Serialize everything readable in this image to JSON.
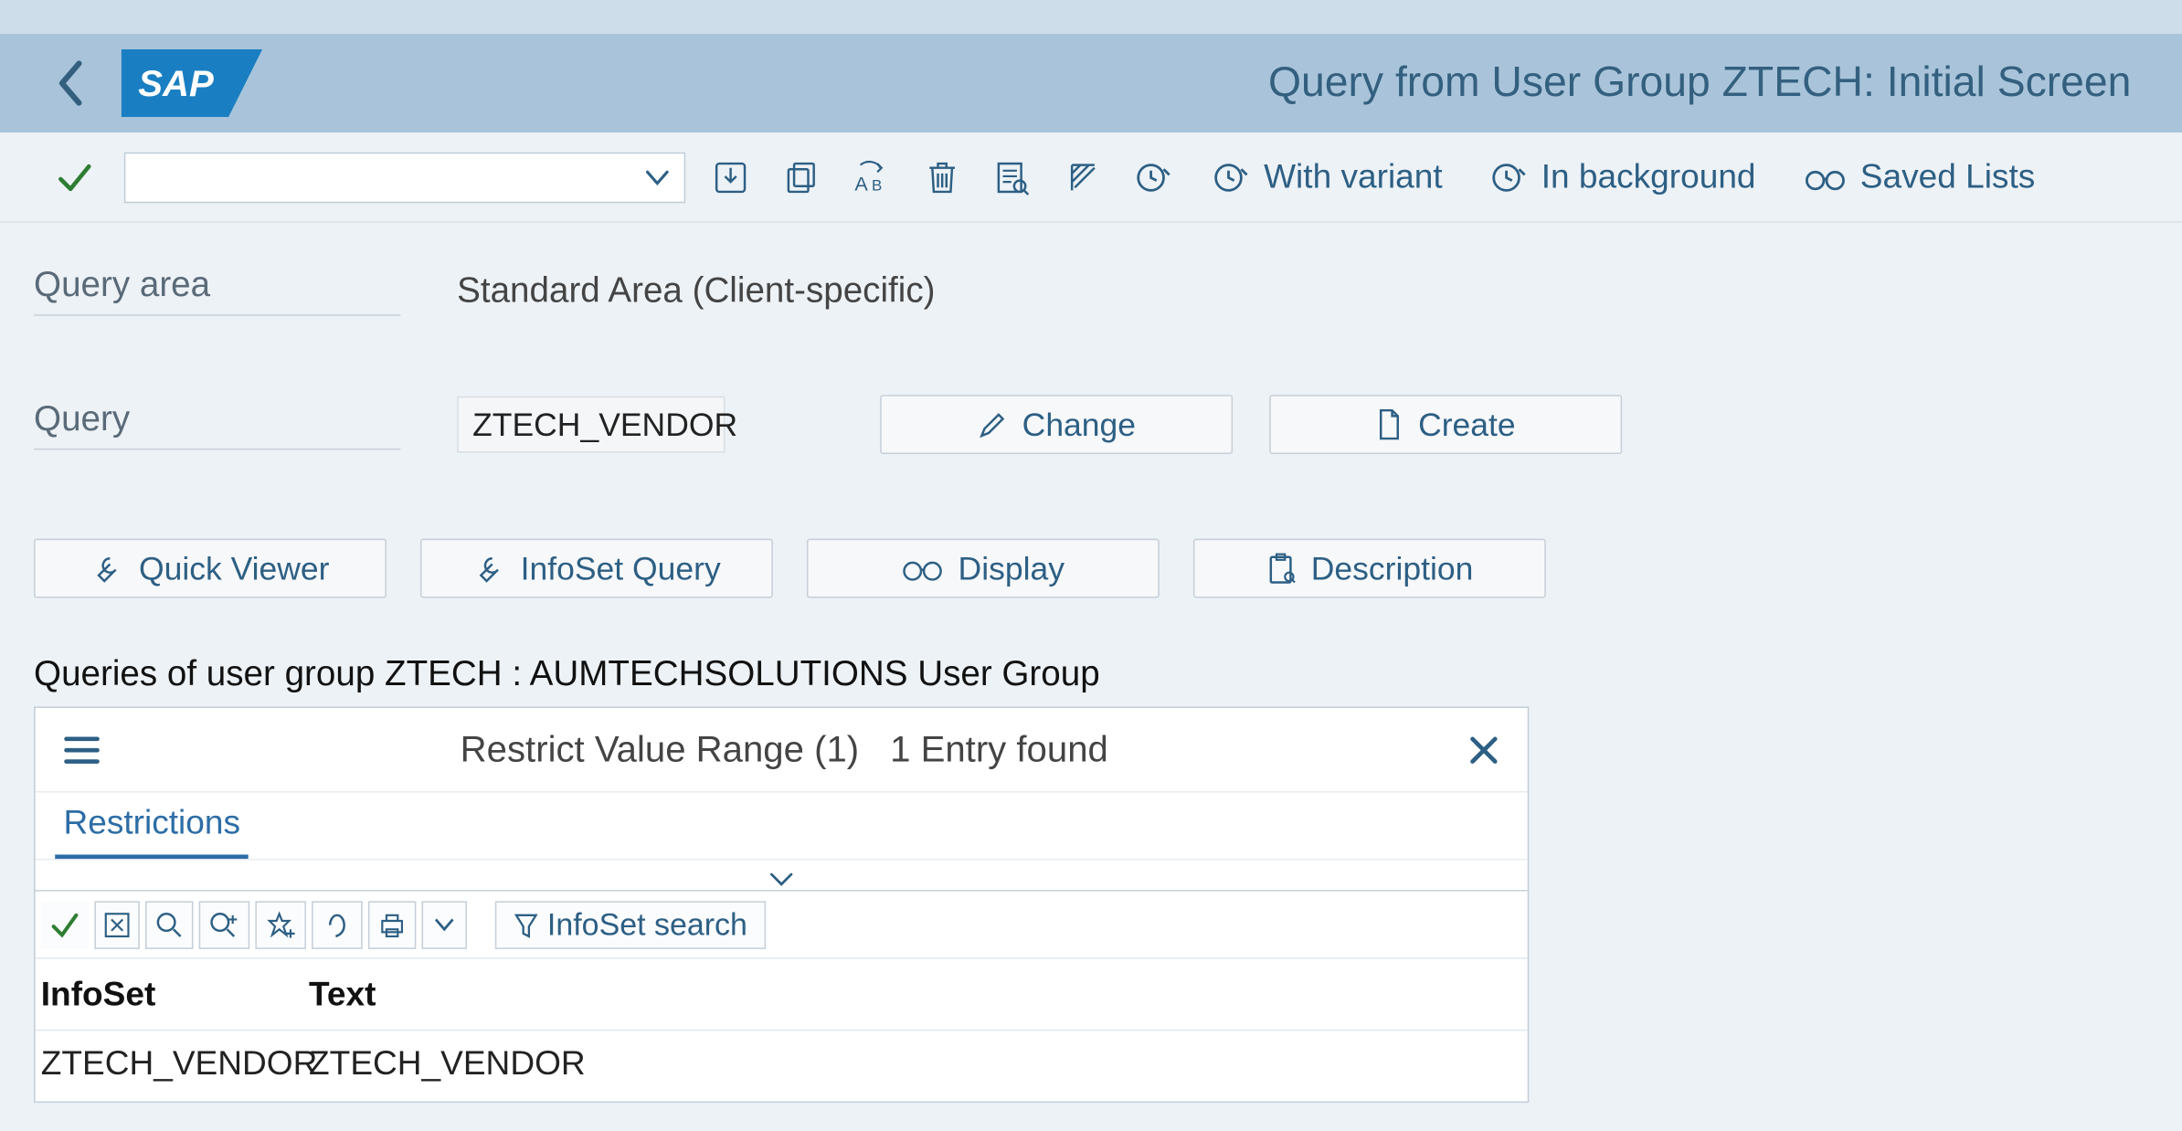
{
  "title": "Query from User Group ZTECH: Initial Screen",
  "toolbar": {
    "with_variant": "With variant",
    "in_background": "In background",
    "saved_lists": "Saved Lists"
  },
  "form": {
    "query_area_label": "Query area",
    "query_area_value": "Standard Area (Client-specific)",
    "query_label": "Query",
    "query_value": "ZTECH_VENDOR",
    "change": "Change",
    "create": "Create",
    "quick_viewer": "Quick Viewer",
    "infoset_query": "InfoSet Query",
    "display": "Display",
    "description": "Description"
  },
  "section_heading": "Queries of user group ZTECH : AUMTECHSOLUTIONS User Group",
  "popup": {
    "title_left": "Restrict Value Range (1)",
    "title_right": "1 Entry found",
    "tab": "Restrictions",
    "infoset_search": "InfoSet search",
    "col_infoset": "InfoSet",
    "col_text": "Text",
    "row_infoset": "ZTECH_VENDOR",
    "row_text": "ZTECH_VENDOR"
  }
}
